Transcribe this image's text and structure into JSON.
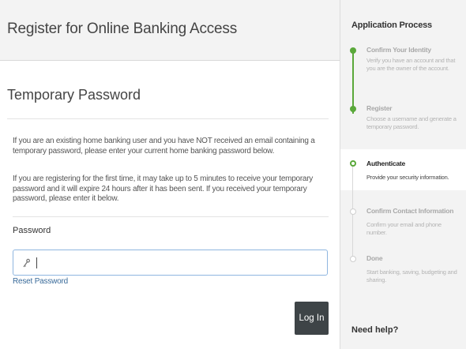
{
  "header": {
    "title": "Register for Online Banking Access"
  },
  "main": {
    "section_title": "Temporary Password",
    "paragraph1": "If you are an existing home banking user and you have NOT received an email containing a temporary password, please enter your current home banking password below.",
    "paragraph2": "If you are registering for the first time, it may take up to 5 minutes to receive your temporary password and it will expire 24 hours after it has been sent. If you received your temporary password, please enter it below.",
    "password_label": "Password",
    "password_value": "",
    "password_icon": "key-icon",
    "reset_link": "Reset Password",
    "login_button": "Log In"
  },
  "sidebar": {
    "title": "Application Process",
    "steps": [
      {
        "title": "Confirm Your Identity",
        "desc": "Verify you have an account and that you are the owner of the account.",
        "status": "done"
      },
      {
        "title": "Register",
        "desc": "Choose a username and generate a temporary password.",
        "status": "done"
      },
      {
        "title": "Authenticate",
        "desc": "Provide your security information.",
        "status": "current"
      },
      {
        "title": "Confirm Contact Information",
        "desc": "Confirm your email and phone number.",
        "status": "todo"
      },
      {
        "title": "Done",
        "desc": "Start banking, saving, budgeting and sharing.",
        "status": "todo"
      }
    ],
    "help": "Need help?"
  },
  "colors": {
    "accent": "#5aa83a",
    "button": "#3e4447",
    "link": "#3a6b9a",
    "input_border": "#8fb6e0"
  }
}
